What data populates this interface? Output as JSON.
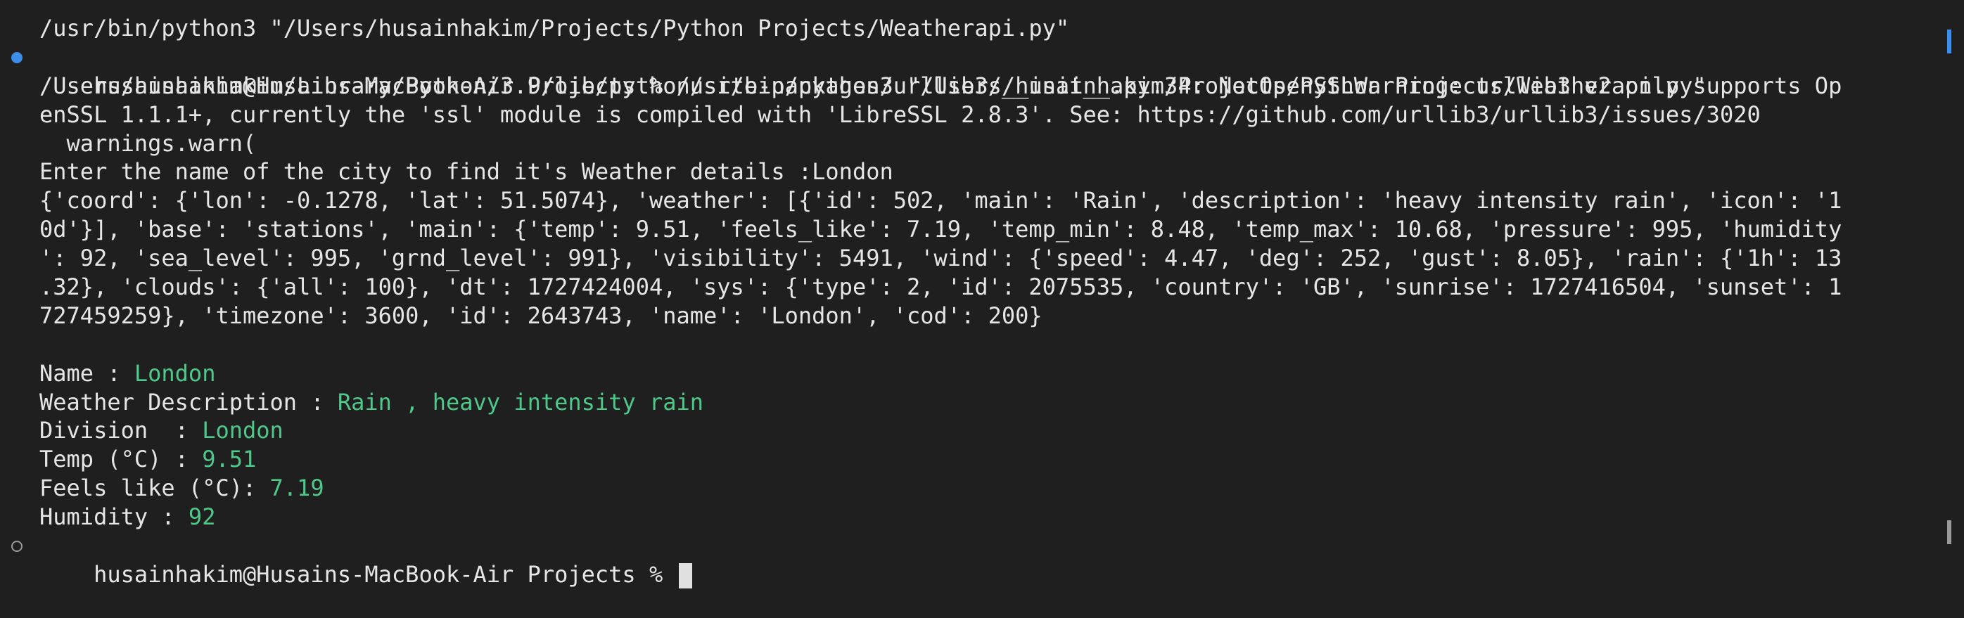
{
  "terminal": {
    "line_prev_command": "/usr/bin/python3 \"/Users/husainhakim/Projects/Python Projects/Weatherapi.py\"",
    "prompt": "husainhakim@Husains-MacBook-Air Projects % ",
    "command": "/usr/bin/python3 \"/Users/husainhakim/Projects/Python Projects/Weatherapi.py\"",
    "warning_lines": [
      "/Users/husainhakim/Library/Python/3.9/lib/python/site-packages/urllib3/__init__.py:34: NotOpenSSLWarning: urllib3 v2 only supports Op",
      "enSSL 1.1.1+, currently the 'ssl' module is compiled with 'LibreSSL 2.8.3'. See: https://github.com/urllib3/urllib3/issues/3020",
      "  warnings.warn("
    ],
    "input_line": "Enter the name of the city to find it's Weather details :London",
    "json_lines": [
      "{'coord': {'lon': -0.1278, 'lat': 51.5074}, 'weather': [{'id': 502, 'main': 'Rain', 'description': 'heavy intensity rain', 'icon': '1",
      "0d'}], 'base': 'stations', 'main': {'temp': 9.51, 'feels_like': 7.19, 'temp_min': 8.48, 'temp_max': 10.68, 'pressure': 995, 'humidity",
      "': 92, 'sea_level': 995, 'grnd_level': 991}, 'visibility': 5491, 'wind': {'speed': 4.47, 'deg': 252, 'gust': 8.05}, 'rain': {'1h': 13",
      ".32}, 'clouds': {'all': 100}, 'dt': 1727424004, 'sys': {'type': 2, 'id': 2075535, 'country': 'GB', 'sunrise': 1727416504, 'sunset': 1",
      "727459259}, 'timezone': 3600, 'id': 2643743, 'name': 'London', 'cod': 200}"
    ],
    "results": {
      "name_label": "Name : ",
      "name_value": "London",
      "description_label": "Weather Description : ",
      "description_value": "Rain , heavy intensity rain",
      "division_label": "Division  : ",
      "division_value": "London",
      "temp_label": "Temp (°C) : ",
      "temp_value": "9.51",
      "feels_label": "Feels like (°C): ",
      "feels_value": "7.19",
      "humidity_label": "Humidity : ",
      "humidity_value": "92"
    },
    "final_prompt": "husainhakim@Husains-MacBook-Air Projects % "
  },
  "colors": {
    "background": "#1f1f1f",
    "text": "#e6e6e6",
    "value_green": "#4ec98a",
    "marker_blue": "#3b8eea",
    "marker_gray": "#9a9a9a"
  }
}
